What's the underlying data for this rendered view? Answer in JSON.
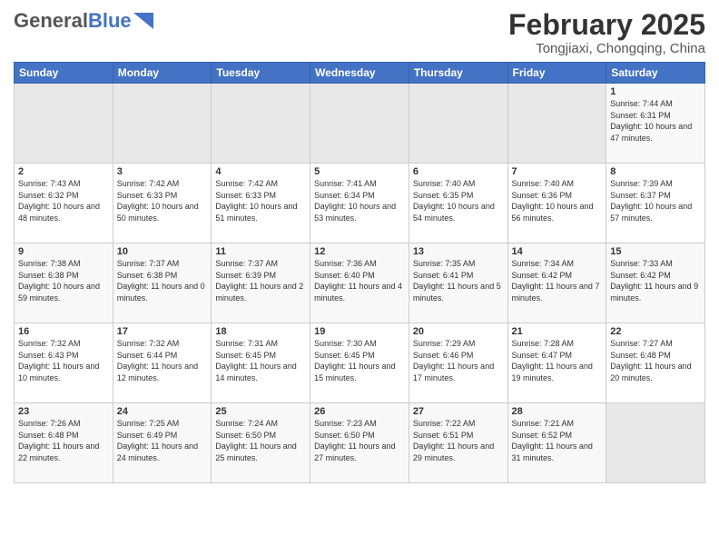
{
  "header": {
    "logo_general": "General",
    "logo_blue": "Blue",
    "month_year": "February 2025",
    "location": "Tongjiaxi, Chongqing, China"
  },
  "weekdays": [
    "Sunday",
    "Monday",
    "Tuesday",
    "Wednesday",
    "Thursday",
    "Friday",
    "Saturday"
  ],
  "weeks": [
    [
      {
        "day": "",
        "empty": true
      },
      {
        "day": "",
        "empty": true
      },
      {
        "day": "",
        "empty": true
      },
      {
        "day": "",
        "empty": true
      },
      {
        "day": "",
        "empty": true
      },
      {
        "day": "",
        "empty": true
      },
      {
        "day": "1",
        "sunrise": "7:44 AM",
        "sunset": "6:31 PM",
        "daylight": "10 hours and 47 minutes."
      }
    ],
    [
      {
        "day": "2",
        "sunrise": "7:43 AM",
        "sunset": "6:32 PM",
        "daylight": "10 hours and 48 minutes."
      },
      {
        "day": "3",
        "sunrise": "7:42 AM",
        "sunset": "6:33 PM",
        "daylight": "10 hours and 50 minutes."
      },
      {
        "day": "4",
        "sunrise": "7:42 AM",
        "sunset": "6:33 PM",
        "daylight": "10 hours and 51 minutes."
      },
      {
        "day": "5",
        "sunrise": "7:41 AM",
        "sunset": "6:34 PM",
        "daylight": "10 hours and 53 minutes."
      },
      {
        "day": "6",
        "sunrise": "7:40 AM",
        "sunset": "6:35 PM",
        "daylight": "10 hours and 54 minutes."
      },
      {
        "day": "7",
        "sunrise": "7:40 AM",
        "sunset": "6:36 PM",
        "daylight": "10 hours and 56 minutes."
      },
      {
        "day": "8",
        "sunrise": "7:39 AM",
        "sunset": "6:37 PM",
        "daylight": "10 hours and 57 minutes."
      }
    ],
    [
      {
        "day": "9",
        "sunrise": "7:38 AM",
        "sunset": "6:38 PM",
        "daylight": "10 hours and 59 minutes."
      },
      {
        "day": "10",
        "sunrise": "7:37 AM",
        "sunset": "6:38 PM",
        "daylight": "11 hours and 0 minutes."
      },
      {
        "day": "11",
        "sunrise": "7:37 AM",
        "sunset": "6:39 PM",
        "daylight": "11 hours and 2 minutes."
      },
      {
        "day": "12",
        "sunrise": "7:36 AM",
        "sunset": "6:40 PM",
        "daylight": "11 hours and 4 minutes."
      },
      {
        "day": "13",
        "sunrise": "7:35 AM",
        "sunset": "6:41 PM",
        "daylight": "11 hours and 5 minutes."
      },
      {
        "day": "14",
        "sunrise": "7:34 AM",
        "sunset": "6:42 PM",
        "daylight": "11 hours and 7 minutes."
      },
      {
        "day": "15",
        "sunrise": "7:33 AM",
        "sunset": "6:42 PM",
        "daylight": "11 hours and 9 minutes."
      }
    ],
    [
      {
        "day": "16",
        "sunrise": "7:32 AM",
        "sunset": "6:43 PM",
        "daylight": "11 hours and 10 minutes."
      },
      {
        "day": "17",
        "sunrise": "7:32 AM",
        "sunset": "6:44 PM",
        "daylight": "11 hours and 12 minutes."
      },
      {
        "day": "18",
        "sunrise": "7:31 AM",
        "sunset": "6:45 PM",
        "daylight": "11 hours and 14 minutes."
      },
      {
        "day": "19",
        "sunrise": "7:30 AM",
        "sunset": "6:45 PM",
        "daylight": "11 hours and 15 minutes."
      },
      {
        "day": "20",
        "sunrise": "7:29 AM",
        "sunset": "6:46 PM",
        "daylight": "11 hours and 17 minutes."
      },
      {
        "day": "21",
        "sunrise": "7:28 AM",
        "sunset": "6:47 PM",
        "daylight": "11 hours and 19 minutes."
      },
      {
        "day": "22",
        "sunrise": "7:27 AM",
        "sunset": "6:48 PM",
        "daylight": "11 hours and 20 minutes."
      }
    ],
    [
      {
        "day": "23",
        "sunrise": "7:26 AM",
        "sunset": "6:48 PM",
        "daylight": "11 hours and 22 minutes."
      },
      {
        "day": "24",
        "sunrise": "7:25 AM",
        "sunset": "6:49 PM",
        "daylight": "11 hours and 24 minutes."
      },
      {
        "day": "25",
        "sunrise": "7:24 AM",
        "sunset": "6:50 PM",
        "daylight": "11 hours and 25 minutes."
      },
      {
        "day": "26",
        "sunrise": "7:23 AM",
        "sunset": "6:50 PM",
        "daylight": "11 hours and 27 minutes."
      },
      {
        "day": "27",
        "sunrise": "7:22 AM",
        "sunset": "6:51 PM",
        "daylight": "11 hours and 29 minutes."
      },
      {
        "day": "28",
        "sunrise": "7:21 AM",
        "sunset": "6:52 PM",
        "daylight": "11 hours and 31 minutes."
      },
      {
        "day": "",
        "empty": true
      }
    ]
  ]
}
